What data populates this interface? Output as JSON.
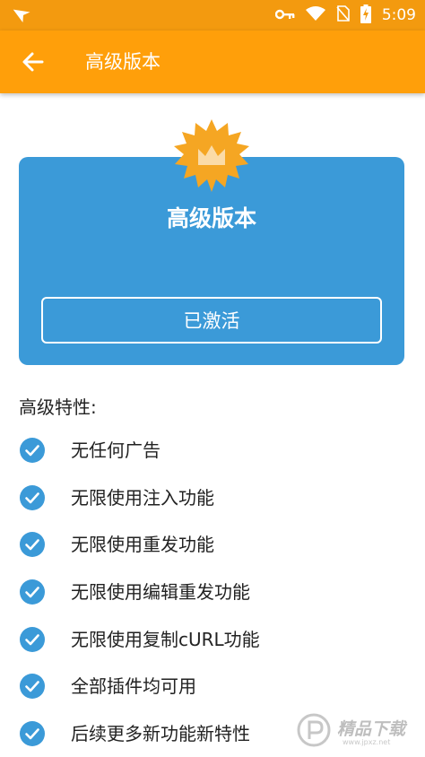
{
  "status_bar": {
    "time": "5:09",
    "icons": [
      "nav-arrow-icon",
      "key-icon",
      "wifi-icon",
      "no-sim-icon",
      "battery-charging-icon"
    ],
    "color": "#f39a0f"
  },
  "app_bar": {
    "title": "高级版本",
    "back_icon": "arrow-left-icon",
    "color": "#ff9f0a"
  },
  "card": {
    "title": "高级版本",
    "badge_icon": "crown-badge-icon",
    "button_label": "已激活",
    "color": "#3b9ad8",
    "badge_color": "#f5a623"
  },
  "features": {
    "heading": "高级特性:",
    "check_icon": "check-circle-icon",
    "items": [
      "无任何广告",
      "无限使用注入功能",
      "无限使用重发功能",
      "无限使用编辑重发功能",
      "无限使用复制cURL功能",
      "全部插件均可用",
      "后续更多新功能新特性"
    ]
  },
  "watermark": {
    "text": "精品下载",
    "sub": "www.jpxz.net"
  }
}
